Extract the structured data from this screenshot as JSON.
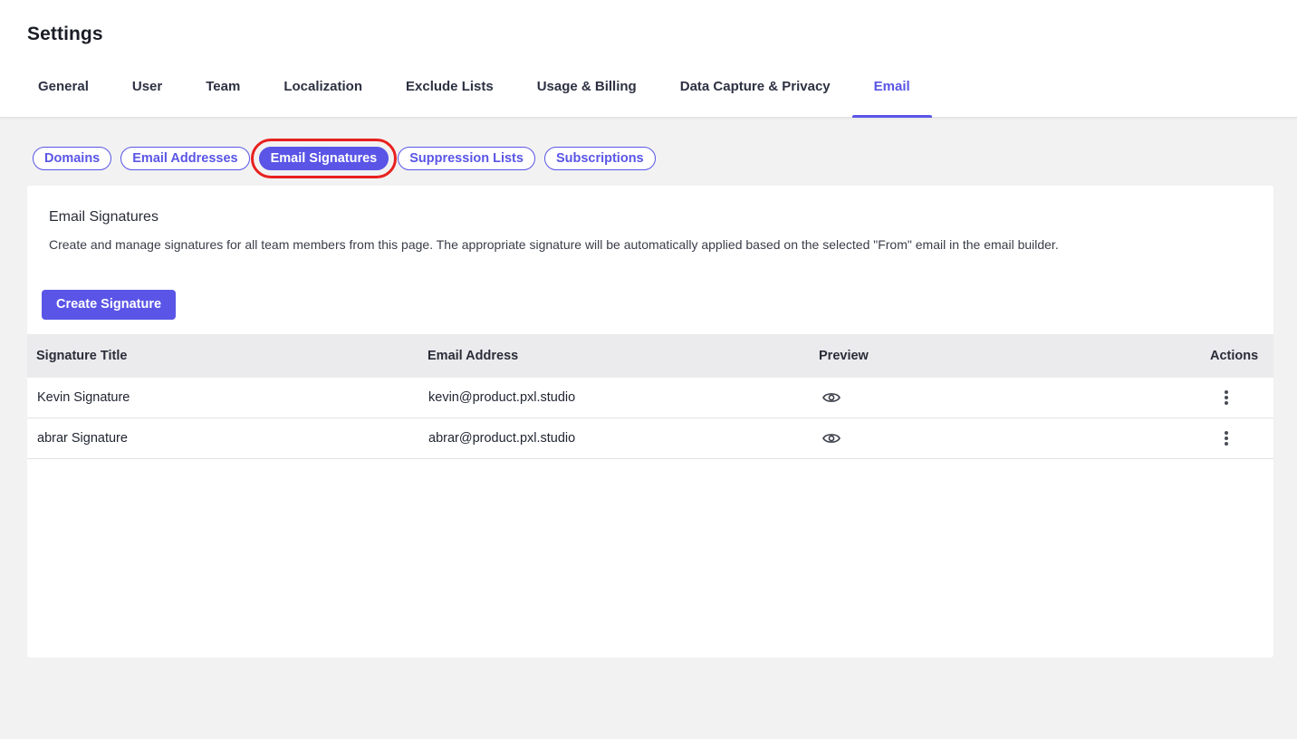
{
  "header": {
    "title": "Settings",
    "tabs": [
      {
        "label": "General"
      },
      {
        "label": "User"
      },
      {
        "label": "Team"
      },
      {
        "label": "Localization"
      },
      {
        "label": "Exclude Lists"
      },
      {
        "label": "Usage & Billing"
      },
      {
        "label": "Data Capture & Privacy"
      },
      {
        "label": "Email"
      }
    ],
    "active_tab": "Email"
  },
  "subtabs": {
    "items": [
      {
        "label": "Domains"
      },
      {
        "label": "Email Addresses"
      },
      {
        "label": "Email Signatures"
      },
      {
        "label": "Suppression Lists"
      },
      {
        "label": "Subscriptions"
      }
    ],
    "active": "Email Signatures",
    "highlight_color": "#e8211f"
  },
  "card": {
    "title": "Email Signatures",
    "description": "Create and manage signatures for all team members from this page. The appropriate signature will be automatically applied based on the selected \"From\" email in the email builder.",
    "create_button": "Create Signature"
  },
  "table": {
    "columns": [
      "Signature Title",
      "Email Address",
      "Preview",
      "Actions"
    ],
    "rows": [
      {
        "title": "Kevin Signature",
        "email": "kevin@product.pxl.studio",
        "preview_icon": "eye-icon",
        "actions_icon": "kebab-menu-icon"
      },
      {
        "title": "abrar Signature",
        "email": "abrar@product.pxl.studio",
        "preview_icon": "eye-icon",
        "actions_icon": "kebab-menu-icon"
      }
    ]
  },
  "colors": {
    "accent": "#5a55e6",
    "background": "#f2f2f2",
    "table_header": "#ebebee"
  }
}
